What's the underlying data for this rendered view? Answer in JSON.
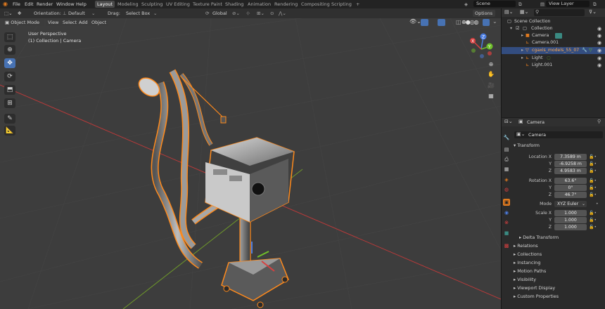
{
  "app": {
    "menus": [
      "File",
      "Edit",
      "Render",
      "Window",
      "Help"
    ],
    "workspaces": [
      "Layout",
      "Modeling",
      "Sculpting",
      "UV Editing",
      "Texture Paint",
      "Shading",
      "Animation",
      "Rendering",
      "Compositing",
      "Scripting",
      "+"
    ],
    "scene": "Scene",
    "view_layer": "View Layer"
  },
  "viewport_header": {
    "orientation_label": "Orientation:",
    "orientation_value": "Default",
    "drag_label": "Drag:",
    "drag_value": "Select Box",
    "transform_orientation": "Global",
    "options": "Options"
  },
  "viewport_header2": {
    "mode": "Object Mode",
    "menus": [
      "View",
      "Select",
      "Add",
      "Object"
    ]
  },
  "viewport": {
    "view_name": "User Perspective",
    "context": "(1) Collection | Camera",
    "gizmo_axes": [
      "Z",
      "Y",
      "X"
    ]
  },
  "outliner": {
    "root": "Scene Collection",
    "items": [
      {
        "label": "Collection",
        "indent": 1
      },
      {
        "label": "Camera",
        "indent": 2
      },
      {
        "label": "Camera.001",
        "indent": 2
      },
      {
        "label": "cgaxis_models_55_07",
        "indent": 2
      },
      {
        "label": "Light",
        "indent": 2
      },
      {
        "label": "Light.001",
        "indent": 2
      }
    ]
  },
  "properties": {
    "breadcrumb": "Camera",
    "object_name": "Camera",
    "transform_title": "Transform",
    "location_label": "Location X",
    "location": [
      "7.3589 m",
      "-6.9258 m",
      "4.9583 m"
    ],
    "rotation_label": "Rotation X",
    "rotation": [
      "63.6°",
      "0°",
      "46.7°"
    ],
    "mode_label": "Mode",
    "mode_value": "XYZ Euler",
    "scale_label": "Scale X",
    "scale": [
      "1.000",
      "1.000",
      "1.000"
    ],
    "axis_y": "Y",
    "axis_z": "Z",
    "delta": "Delta Transform",
    "sections": [
      "Relations",
      "Collections",
      "Instancing",
      "Motion Paths",
      "Visibility",
      "Viewport Display",
      "Custom Properties"
    ]
  },
  "colors": {
    "accent": "#4772b3",
    "selection_outline": "#ff8a1c",
    "x_axis": "#b83a3a",
    "y_axis": "#6f9a2a"
  }
}
